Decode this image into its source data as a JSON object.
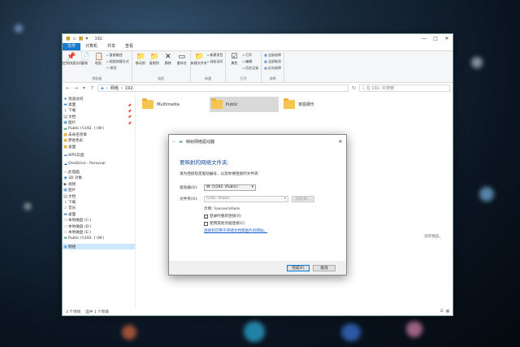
{
  "window": {
    "title": "192.",
    "controls": [
      "—",
      "□",
      "✕"
    ],
    "tabs": [
      "文件",
      "计算机",
      "共享",
      "查看"
    ]
  },
  "ribbon": {
    "groups": [
      {
        "label": "剪贴板",
        "buttons": [
          {
            "icon": "pin-icon",
            "glyph": "📌",
            "label": "固定到快速访问"
          },
          {
            "icon": "copy-icon",
            "glyph": "📄",
            "label": "复制"
          },
          {
            "icon": "paste-icon",
            "glyph": "📋",
            "label": "粘贴"
          }
        ],
        "small": [
          {
            "icon": "copy-path-icon",
            "glyph": "▫",
            "label": "复制路径"
          },
          {
            "icon": "paste-shortcut-icon",
            "glyph": "▫",
            "label": "粘贴快捷方式"
          },
          {
            "icon": "cut-icon",
            "glyph": "✂",
            "label": "剪切"
          }
        ]
      },
      {
        "label": "组织",
        "buttons": [
          {
            "icon": "move-to-icon",
            "glyph": "📁",
            "label": "移动到"
          },
          {
            "icon": "copy-to-icon",
            "glyph": "📁",
            "label": "复制到"
          },
          {
            "icon": "delete-icon",
            "glyph": "✕",
            "label": "删除"
          },
          {
            "icon": "rename-icon",
            "glyph": "▭",
            "label": "重命名"
          }
        ]
      },
      {
        "label": "新建",
        "buttons": [
          {
            "icon": "new-folder-icon",
            "glyph": "📁",
            "label": "新建文件夹"
          }
        ],
        "small": [
          {
            "icon": "new-item-icon",
            "glyph": "▫",
            "label": "新建项目"
          },
          {
            "icon": "easy-access-icon",
            "glyph": "▫",
            "label": "轻松访问"
          }
        ]
      },
      {
        "label": "打开",
        "buttons": [
          {
            "icon": "properties-icon",
            "glyph": "☑",
            "label": "属性"
          }
        ],
        "small": [
          {
            "icon": "open-icon",
            "glyph": "▫",
            "label": "打开"
          },
          {
            "icon": "edit-icon",
            "glyph": "▫",
            "label": "编辑"
          },
          {
            "icon": "history-icon",
            "glyph": "▫",
            "label": "历史记录"
          }
        ]
      },
      {
        "label": "选择",
        "small": [
          {
            "icon": "select-all-icon",
            "glyph": "▦",
            "label": "全部选择"
          },
          {
            "icon": "select-none-icon",
            "glyph": "▦",
            "label": "全部取消"
          },
          {
            "icon": "invert-selection-icon",
            "glyph": "▦",
            "label": "反向选择"
          }
        ]
      }
    ]
  },
  "address": {
    "path": [
      "网络",
      "192."
    ],
    "search_placeholder": "在 192. 中搜索"
  },
  "sidebar": [
    {
      "icon": "star-icon",
      "glyph": "★",
      "label": "快速访问",
      "color": "#2a7bd4"
    },
    {
      "icon": "desktop-icon",
      "glyph": "▬",
      "label": "桌面",
      "color": "#3b8ee0",
      "pin": "📌"
    },
    {
      "icon": "download-icon",
      "glyph": "↓",
      "label": "下载",
      "color": "#2a7bd4",
      "pin": "📌"
    },
    {
      "icon": "documents-icon",
      "glyph": "▤",
      "label": "文档",
      "color": "#666",
      "pin": "📌"
    },
    {
      "icon": "pictures-icon",
      "glyph": "▣",
      "label": "图片",
      "color": "#3a8fd9",
      "pin": "📌"
    },
    {
      "icon": "network-drive-icon",
      "glyph": "▬",
      "label": "Public (\\\\192.            ) (W:)",
      "color": "#4a7"
    },
    {
      "icon": "folder-icon",
      "glyph": "■",
      "label": "未命名项目",
      "color": "#e8b33e"
    },
    {
      "icon": "folder-icon",
      "glyph": "■",
      "label": "原始色彩",
      "color": "#e8b33e"
    },
    {
      "icon": "folder-icon",
      "glyph": "■",
      "label": "桌面",
      "color": "#e8b33e"
    },
    {
      "icon": "wps-cloud-icon",
      "glyph": "☁",
      "label": "WPS云盘",
      "color": "#3f7fd9",
      "gap": true
    },
    {
      "icon": "onedrive-icon",
      "glyph": "☁",
      "label": "OneDrive - Personal",
      "color": "#2a7bd4",
      "gap": true
    },
    {
      "icon": "this-pc-icon",
      "glyph": "▭",
      "label": "此电脑",
      "color": "#3a8fd9",
      "gap": true
    },
    {
      "icon": "3d-objects-icon",
      "glyph": "◆",
      "label": "3D 对象",
      "color": "#3a8fd9"
    },
    {
      "icon": "video-icon",
      "glyph": "▶",
      "label": "视频",
      "color": "#555"
    },
    {
      "icon": "pictures-icon",
      "glyph": "▣",
      "label": "图片",
      "color": "#3a8fd9"
    },
    {
      "icon": "documents-icon",
      "glyph": "▤",
      "label": "文档",
      "color": "#666"
    },
    {
      "icon": "download-icon",
      "glyph": "↓",
      "label": "下载",
      "color": "#2a7bd4"
    },
    {
      "icon": "music-icon",
      "glyph": "♪",
      "label": "音乐",
      "color": "#2a7bd4"
    },
    {
      "icon": "desktop-icon",
      "glyph": "▬",
      "label": "桌面",
      "color": "#3b8ee0"
    },
    {
      "icon": "drive-icon",
      "glyph": "▭",
      "label": "本地磁盘 (C:)",
      "color": "#777"
    },
    {
      "icon": "drive-icon",
      "glyph": "▭",
      "label": "本地磁盘 (D:)",
      "color": "#777"
    },
    {
      "icon": "drive-icon",
      "glyph": "▭",
      "label": "本地磁盘 (E:)",
      "color": "#777"
    },
    {
      "icon": "network-drive-icon",
      "glyph": "▬",
      "label": "Public (\\\\192.            ) (W:)",
      "color": "#4a7"
    },
    {
      "icon": "network-icon",
      "glyph": "◈",
      "label": "网络",
      "color": "#2a7bd4",
      "selected": true,
      "gap": true
    }
  ],
  "folders": [
    {
      "label": "Multimedia",
      "selected": false
    },
    {
      "label": "Public",
      "selected": true
    },
    {
      "label": "家庭娱乐",
      "selected": false
    }
  ],
  "preview_text": "没有预览。",
  "status": {
    "count": "3 个项目",
    "selected": "选中 1 个项目"
  },
  "dialog": {
    "title": "映射网络驱动器",
    "heading": "要映射的网络文件夹:",
    "description": "请为连接指定驱动器号，以及你要连接的文件夹:",
    "drive_label": "驱动器(D):",
    "drive_value": "W: (\\\\192.           \\Public)",
    "folder_label": "文件夹(O):",
    "folder_value": "\\\\192.              \\Public",
    "browse_label": "浏览(B)...",
    "example": "示例: \\\\server\\share",
    "reconnect_label": "登录时重新连接(R)",
    "reconnect_checked": true,
    "credentials_label": "使用其他凭据连接(C)",
    "credentials_checked": false,
    "link_text": "连接到可用于存储文档和图片的网站。",
    "finish_label": "完成(F)",
    "cancel_label": "取消"
  }
}
